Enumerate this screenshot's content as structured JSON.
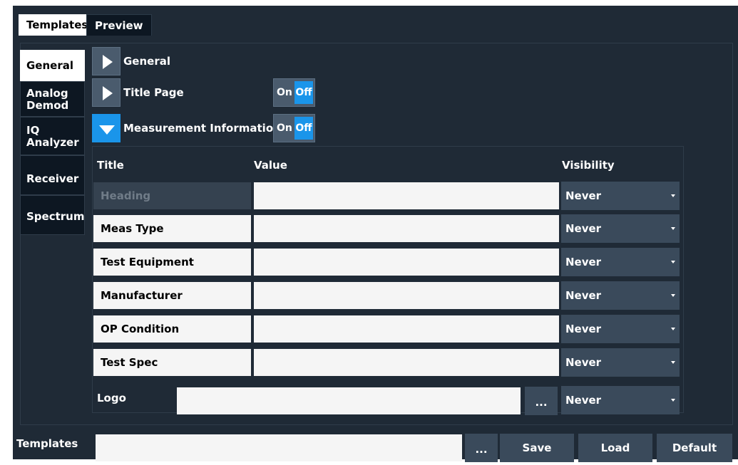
{
  "tabs": [
    "Templates",
    "Preview"
  ],
  "side_tabs": [
    {
      "lines": [
        "General"
      ],
      "active": true
    },
    {
      "lines": [
        "Analog",
        "Demod"
      ],
      "active": false
    },
    {
      "lines": [
        "IQ",
        "Analyzer"
      ],
      "active": false
    },
    {
      "lines": [
        "Receiver"
      ],
      "active": false
    },
    {
      "lines": [
        "Spectrum"
      ],
      "active": false
    }
  ],
  "sections": [
    {
      "label": "General",
      "expanded": false
    },
    {
      "label": "Title Page",
      "expanded": false,
      "toggle": {
        "on": "On",
        "off": "Off"
      }
    },
    {
      "label": "Measurement Information",
      "expanded": true,
      "toggle": {
        "on": "On",
        "off": "Off"
      }
    }
  ],
  "table": {
    "headers": {
      "title": "Title",
      "value": "Value",
      "visibility": "Visibility"
    },
    "rows": [
      {
        "title": "Heading",
        "value": "",
        "visibility": "Never",
        "disabled": true
      },
      {
        "title": "Meas Type",
        "value": "",
        "visibility": "Never"
      },
      {
        "title": "Test Equipment",
        "value": "",
        "visibility": "Never"
      },
      {
        "title": "Manufacturer",
        "value": "",
        "visibility": "Never"
      },
      {
        "title": "OP Condition",
        "value": "",
        "visibility": "Never"
      },
      {
        "title": "Test Spec",
        "value": "",
        "visibility": "Never"
      }
    ],
    "logo": {
      "label": "Logo",
      "value": "",
      "browse": "...",
      "visibility": "Never"
    }
  },
  "bottom": {
    "label": "Templates",
    "value": "",
    "browse": "...",
    "buttons": [
      "Save",
      "Load",
      "Default"
    ]
  },
  "colors": {
    "accent": "#1a95ea",
    "background": "#1f2a36",
    "button": "#3a4a5b"
  }
}
